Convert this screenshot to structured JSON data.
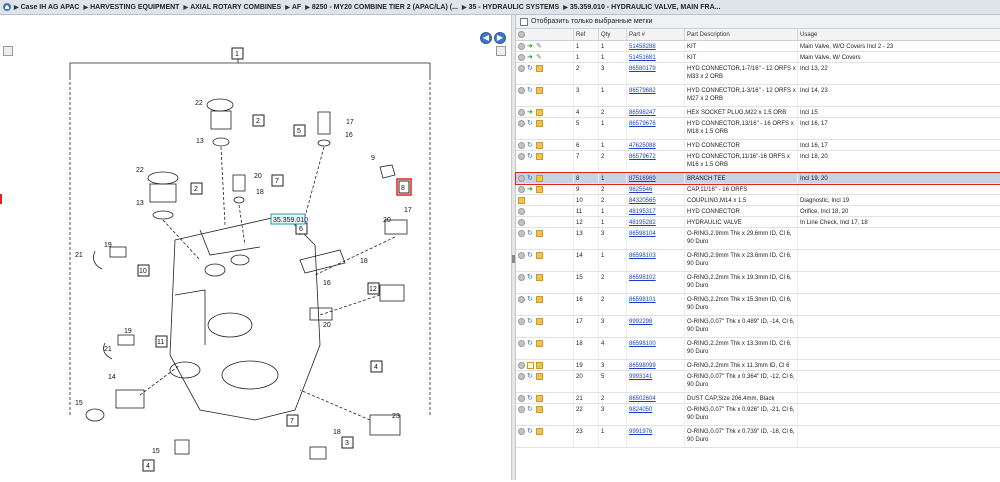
{
  "breadcrumb": {
    "items": [
      "Case IH AG APAC",
      "HARVESTING EQUIPMENT",
      "AXIAL ROTARY COMBINES",
      "AF",
      "8250 - MY20 COMBINE TIER 2 (APAC/LA) (...",
      "35 - HYDRAULIC SYSTEMS",
      "35.359.010 - HYDRAULIC VALVE, MAIN FRA..."
    ]
  },
  "diagram": {
    "section_label": "35.359.010",
    "callouts": [
      "1",
      "2",
      "3",
      "4",
      "5",
      "6",
      "7",
      "8",
      "9",
      "10",
      "11",
      "12",
      "13",
      "14",
      "15",
      "16",
      "17",
      "18",
      "19",
      "20",
      "21",
      "22",
      "23"
    ]
  },
  "right": {
    "option_label": "Отобразить только выбранные метки",
    "columns": {
      "ref": "Ref",
      "qty": "Qty",
      "part": "Part #",
      "desc": "Part Description",
      "usage": "Usage"
    },
    "rows": [
      {
        "ref": "1",
        "qty": "1",
        "part": "51458288",
        "desc": "KIT",
        "usage": "Main Valve, W/O Covers Incl 2 - 23",
        "icons": [
          "grey",
          "green",
          "wrench"
        ]
      },
      {
        "ref": "1",
        "qty": "1",
        "part": "51451681",
        "desc": "KIT",
        "usage": "Main Valve, W/ Covers",
        "icons": [
          "grey",
          "green",
          "wrench"
        ]
      },
      {
        "ref": "2",
        "qty": "3",
        "part": "86580179",
        "desc": "HYD CONNECTOR,1-7/16\" - 12 ORFS x M33 x 2 ORB",
        "usage": "Incl 13, 22",
        "icons": [
          "grey",
          "blue",
          "box"
        ]
      },
      {
        "ref": "3",
        "qty": "1",
        "part": "86579682",
        "desc": "HYD CONNECTOR,1-3/16\" - 12 ORFS x M27 x 2 ORB",
        "usage": "Incl 14, 23",
        "icons": [
          "grey",
          "blue",
          "box"
        ]
      },
      {
        "ref": "4",
        "qty": "2",
        "part": "86598247",
        "desc": "HEX SOCKET PLUG,M22 x 1.5 ORB",
        "usage": "Incl 15",
        "icons": [
          "grey",
          "green",
          "box"
        ]
      },
      {
        "ref": "5",
        "qty": "1",
        "part": "86579676",
        "desc": "HYD CONNECTOR,13/16\" - 16 ORFS x M18 x 1.5 ORB",
        "usage": "Incl 16, 17",
        "icons": [
          "grey",
          "blue",
          "box"
        ]
      },
      {
        "ref": "6",
        "qty": "1",
        "part": "47625088",
        "desc": "HYD CONNECTOR",
        "usage": "Incl 16, 17",
        "icons": [
          "grey",
          "blue",
          "box"
        ]
      },
      {
        "ref": "7",
        "qty": "2",
        "part": "86579672",
        "desc": "HYD CONNECTOR,11/16\"-16 ORFS x M16 x 1.5 ORB",
        "usage": "Incl 18, 20",
        "icons": [
          "grey",
          "blue",
          "box"
        ]
      },
      {
        "ref": "8",
        "qty": "1",
        "part": "87516969",
        "desc": "BRANCH TEE",
        "usage": "Incl 19, 20",
        "icons": [
          "grey",
          "blue",
          "box"
        ],
        "selected": true
      },
      {
        "ref": "9",
        "qty": "2",
        "part": "9625546",
        "desc": "CAP,11/16\" - 16 ORFS",
        "usage": "",
        "icons": [
          "grey",
          "green",
          "box"
        ]
      },
      {
        "ref": "10",
        "qty": "2",
        "part": "84320565",
        "desc": "COUPLING,M14 x 1.5",
        "usage": "Diagnostic, Incl 19",
        "icons": [
          "box"
        ]
      },
      {
        "ref": "11",
        "qty": "1",
        "part": "48195317",
        "desc": "HYD CONNECTOR",
        "usage": "Orifice, Incl 18, 20",
        "icons": [
          "grey"
        ]
      },
      {
        "ref": "12",
        "qty": "1",
        "part": "48195282",
        "desc": "HYDRAULIC VALVE",
        "usage": "In Line Check, Incl 17, 18",
        "icons": [
          "grey"
        ]
      },
      {
        "ref": "13",
        "qty": "3",
        "part": "86598104",
        "desc": "O-RING,2.9mm Thk x 29.6mm ID, Cl 6, 90 Duro",
        "usage": "",
        "icons": [
          "grey",
          "blue",
          "box"
        ]
      },
      {
        "ref": "14",
        "qty": "1",
        "part": "86598103",
        "desc": "O-RING,2.9mm Thk x 23.6mm ID, Cl 6, 90 Duro",
        "usage": "",
        "icons": [
          "grey",
          "blue",
          "box"
        ]
      },
      {
        "ref": "15",
        "qty": "2",
        "part": "86598102",
        "desc": "O-RING,2.2mm Thk x 19.3mm ID, Cl 6, 90 Duro",
        "usage": "",
        "icons": [
          "grey",
          "blue",
          "box"
        ]
      },
      {
        "ref": "16",
        "qty": "2",
        "part": "86598101",
        "desc": "O-RING,2.2mm Thk x 15.3mm ID, Cl 6, 90 Duro",
        "usage": "",
        "icons": [
          "grey",
          "blue",
          "box"
        ]
      },
      {
        "ref": "17",
        "qty": "3",
        "part": "9992298",
        "desc": "O-RING,0.07\" Thk x 0.489\" ID, -14, Cl 6, 90 Duro",
        "usage": "",
        "icons": [
          "grey",
          "blue",
          "box"
        ]
      },
      {
        "ref": "18",
        "qty": "4",
        "part": "86598100",
        "desc": "O-RING,2.2mm Thk x 13.3mm ID, Cl 6, 90 Duro",
        "usage": "",
        "icons": [
          "grey",
          "blue",
          "box"
        ]
      },
      {
        "ref": "19",
        "qty": "3",
        "part": "86598099",
        "desc": "O-RING,2.2mm Thk x 11.3mm ID, Cl 6",
        "usage": "",
        "icons": [
          "grey",
          "doc",
          "box"
        ]
      },
      {
        "ref": "20",
        "qty": "5",
        "part": "9993141",
        "desc": "O-RING,0.07\" Thk x 0.364\" ID, -12, Cl 6, 90 Duro",
        "usage": "",
        "icons": [
          "grey",
          "blue",
          "box"
        ]
      },
      {
        "ref": "21",
        "qty": "2",
        "part": "86502604",
        "desc": "DUST CAP,Size 206.4mm, Black",
        "usage": "",
        "icons": [
          "grey",
          "blue",
          "box"
        ]
      },
      {
        "ref": "22",
        "qty": "3",
        "part": "9824050",
        "desc": "O-RING,0.07\" Thk x 0.926\" ID, -21, Cl 6, 90 Duro",
        "usage": "",
        "icons": [
          "grey",
          "blue",
          "box"
        ]
      },
      {
        "ref": "23",
        "qty": "1",
        "part": "9991976",
        "desc": "O-RING,0.07\" Thk x 0.739\" ID, -18, Cl 6, 90 Duro",
        "usage": "",
        "icons": [
          "grey",
          "blue",
          "box"
        ]
      }
    ]
  }
}
